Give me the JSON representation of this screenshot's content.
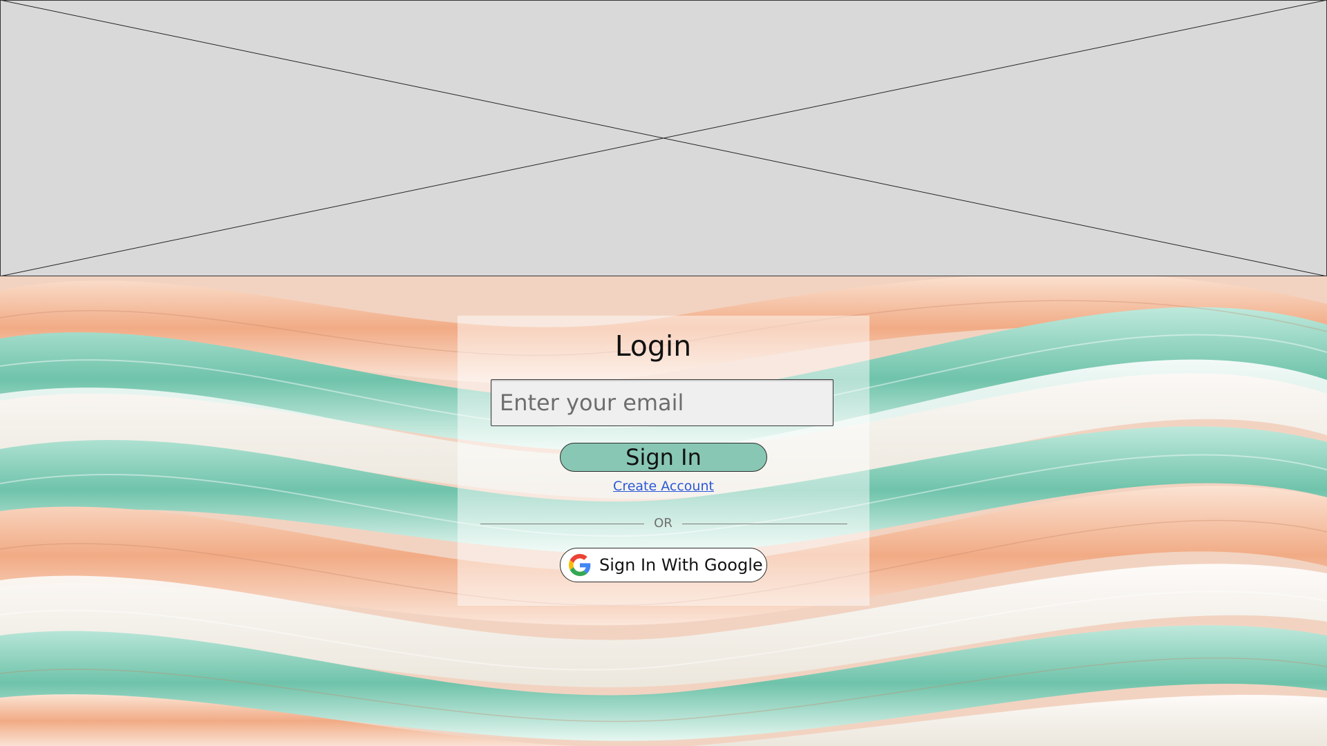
{
  "hero": {
    "image_placeholder": "image-placeholder"
  },
  "login": {
    "title": "Login",
    "email_placeholder": "Enter your email",
    "signin_label": "Sign In",
    "create_account_label": "Create Account",
    "divider_label": "OR",
    "google_label": "Sign In With Google"
  },
  "colors": {
    "signin_button": "#88c7b3",
    "link": "#2a58d6",
    "placeholder_bg": "#d9d9d9"
  },
  "icons": {
    "google": "google-g-icon"
  }
}
